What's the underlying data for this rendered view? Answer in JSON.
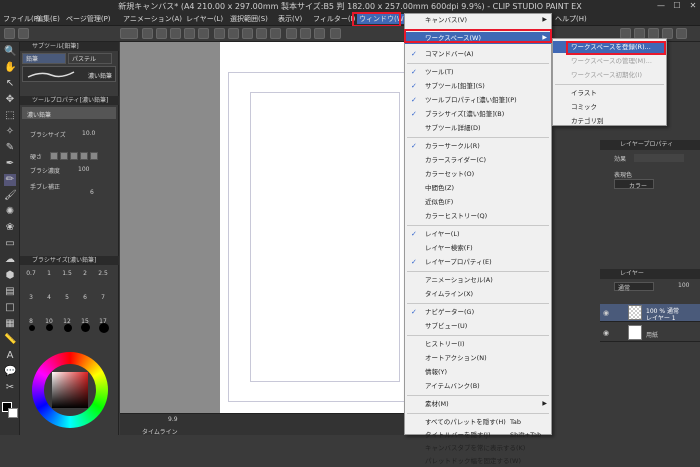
{
  "window": {
    "title": "新規キャンバス* (A4 210.00 x 297.00mm 製本サイズ:B5 判 182.00 x 257.00mm 600dpi 9.9%) - CLIP STUDIO PAINT EX",
    "minimize": "—",
    "maximize": "☐",
    "close": "✕"
  },
  "menubar": {
    "items": [
      "ファイル(F)",
      "編集(E)",
      "ページ管理(P)",
      "アニメーション(A)",
      "レイヤー(L)",
      "選択範囲(S)",
      "表示(V)",
      "フィルター(I)",
      "ウィンドウ(W)",
      "ヘルプ(H)"
    ]
  },
  "left_panel": {
    "subtool_header": "サブツール[鉛筆]",
    "tab_pencil": "鉛筆",
    "tab_pastel": "パステル",
    "brush_name": "濃い鉛筆",
    "toolprop_header": "ツールプロパティ[濃い鉛筆]",
    "toolprop_brush": "濃い鉛筆",
    "brush_size_label": "ブラシサイズ",
    "brush_size_value": "10.0",
    "hardness_label": "硬さ",
    "density_label": "ブラシ濃度",
    "density_value": "100",
    "stabilizer_label": "手ブレ補正",
    "stabilizer_value": "6",
    "brushsize_header": "ブラシサイズ[濃い鉛筆]",
    "sizes_row1": [
      "0.7",
      "1",
      "1.5",
      "2",
      "2.5"
    ],
    "sizes_row2": [
      "3",
      "4",
      "5",
      "6",
      "7"
    ],
    "sizes_row3": [
      "8",
      "10",
      "12",
      "15",
      "17"
    ]
  },
  "status": {
    "zoom": "9.9",
    "timeline": "タイムライン"
  },
  "menu_window": {
    "items": [
      {
        "label": "キャンバス(V)",
        "check": false,
        "arrow": true
      },
      {
        "label": "ワークスペース(W)",
        "check": false,
        "arrow": true,
        "highlight": true
      },
      {
        "label": "コマンドバー(A)",
        "check": true
      },
      {
        "label": "ツール(T)",
        "check": true
      },
      {
        "label": "サブツール[鉛筆](S)",
        "check": true
      },
      {
        "label": "ツールプロパティ[濃い鉛筆](P)",
        "check": true
      },
      {
        "label": "ブラシサイズ[濃い鉛筆](B)",
        "check": true
      },
      {
        "label": "サブツール詳細(D)",
        "check": false
      },
      {
        "label": "カラーサークル(R)",
        "check": true
      },
      {
        "label": "カラースライダー(C)",
        "check": false
      },
      {
        "label": "カラーセット(O)",
        "check": false
      },
      {
        "label": "中間色(Z)",
        "check": false
      },
      {
        "label": "近似色(F)",
        "check": false
      },
      {
        "label": "カラーヒストリー(Q)",
        "check": false
      },
      {
        "label": "レイヤー(L)",
        "check": true
      },
      {
        "label": "レイヤー検索(F)",
        "check": false
      },
      {
        "label": "レイヤープロパティ(E)",
        "check": true
      },
      {
        "label": "アニメーションセル(A)",
        "check": false
      },
      {
        "label": "タイムライン(X)",
        "check": false
      },
      {
        "label": "ナビゲーター(G)",
        "check": true
      },
      {
        "label": "サブビュー(U)",
        "check": false
      },
      {
        "label": "ヒストリー(I)",
        "check": false
      },
      {
        "label": "オートアクション(N)",
        "check": false
      },
      {
        "label": "情報(Y)",
        "check": false
      },
      {
        "label": "アイテムバンク(B)",
        "check": false
      },
      {
        "label": "素材(M)",
        "check": false,
        "arrow": true
      },
      {
        "label": "すべてのパレットを隠す(H)",
        "shortcut": "Tab"
      },
      {
        "label": "タイトルバーを隠す(J)",
        "shortcut": "Shift+Tab"
      },
      {
        "label": "キャンバスタブを常に表示する(K)"
      },
      {
        "label": "パレットドック幅を固定する(W)"
      }
    ]
  },
  "menu_workspace": {
    "items": [
      {
        "label": "ワークスペースを登録(R)...",
        "highlight": true
      },
      {
        "label": "ワークスペースの管理(M)...",
        "disabled": true
      },
      {
        "label": "ワークスペース初期化(I)",
        "disabled": true
      },
      {
        "label": "イラスト"
      },
      {
        "label": "コミック"
      },
      {
        "label": "カテゴリ別"
      }
    ]
  },
  "right_panel": {
    "layerprop_header": "レイヤープロパティ",
    "effect_label": "効果",
    "display_color_label": "表現色",
    "display_color_value": "カラー",
    "layer_header": "レイヤー",
    "blend_mode": "通常",
    "opacity": "100",
    "layer1_info": "100 % 通常",
    "layer1_name": "レイヤー 1",
    "paper_name": "用紙"
  },
  "colors": {
    "menu_highlight": "#3f68b5",
    "annotation_red": "#e8182b",
    "check_blue": "#3366cc"
  }
}
